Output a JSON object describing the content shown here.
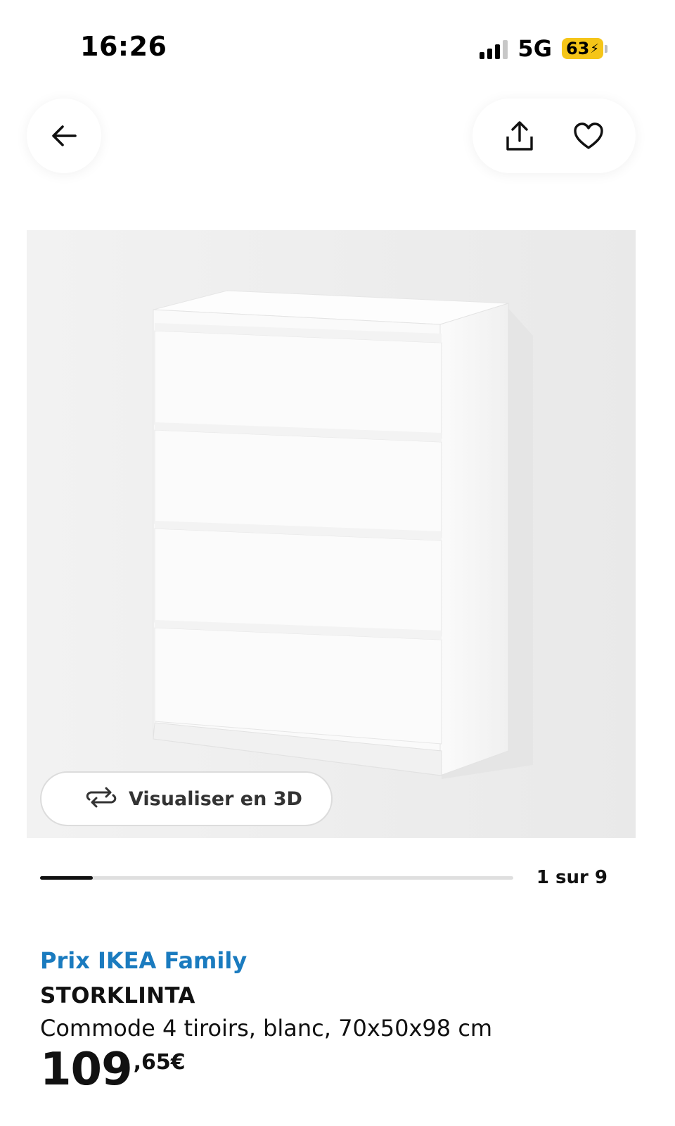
{
  "status_bar": {
    "time": "16:26",
    "network": "5G",
    "battery": "63",
    "battery_charging_glyph": "⚡"
  },
  "nav": {
    "back_icon": "arrow-left-icon",
    "share_icon": "share-icon",
    "favorite_icon": "heart-icon"
  },
  "gallery": {
    "view_3d_label": "Visualiser en 3D",
    "view_3d_icon": "rotate-3d-icon",
    "counter": "1 sur 9",
    "current_index": 1,
    "total_images": 9
  },
  "product": {
    "price_label": "Prix IKEA Family",
    "name": "STORKLINTA",
    "description": "Commode 4 tiroirs, blanc, 70x50x98 cm",
    "price_integer": "109",
    "price_decimal": ",65€"
  },
  "colors": {
    "family_blue": "#1a7bbf",
    "battery_yellow": "#f5c518",
    "image_background": "#efefef"
  }
}
